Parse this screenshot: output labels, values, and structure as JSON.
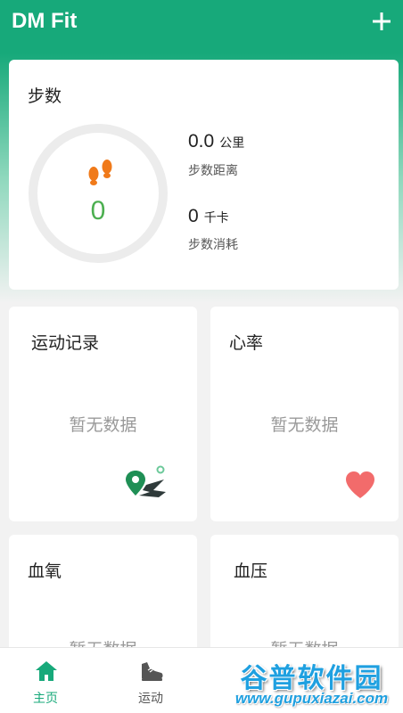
{
  "app": {
    "title": "DM Fit"
  },
  "steps_card": {
    "title": "步数",
    "step_count": "0",
    "distance_value": "0.0",
    "distance_unit": "公里",
    "distance_label": "步数距离",
    "calorie_value": "0",
    "calorie_unit": "千卡",
    "calorie_label": "步数消耗"
  },
  "exercise_card": {
    "title": "运动记录",
    "empty": "暂无数据"
  },
  "heart_card": {
    "title": "心率",
    "empty": "暂无数据"
  },
  "oxygen_card": {
    "title": "血氧",
    "empty": "暂无数据"
  },
  "pressure_card": {
    "title": "血压",
    "empty": "暂无数据"
  },
  "bottom_nav": {
    "items": [
      {
        "label": "主页",
        "icon": "home-icon",
        "active": true
      },
      {
        "label": "运动",
        "icon": "sneaker-icon",
        "active": false
      }
    ]
  },
  "watermark": {
    "line1": "谷普软件园",
    "line2": "www.gupuxiazai.com"
  },
  "colors": {
    "brand": "#17a97a",
    "active_nav": "#17a97a",
    "steps_icon": "#f07a1a",
    "step_count": "#4caf50",
    "heart": "#f26b6b",
    "map_pin": "#1f8f55"
  }
}
